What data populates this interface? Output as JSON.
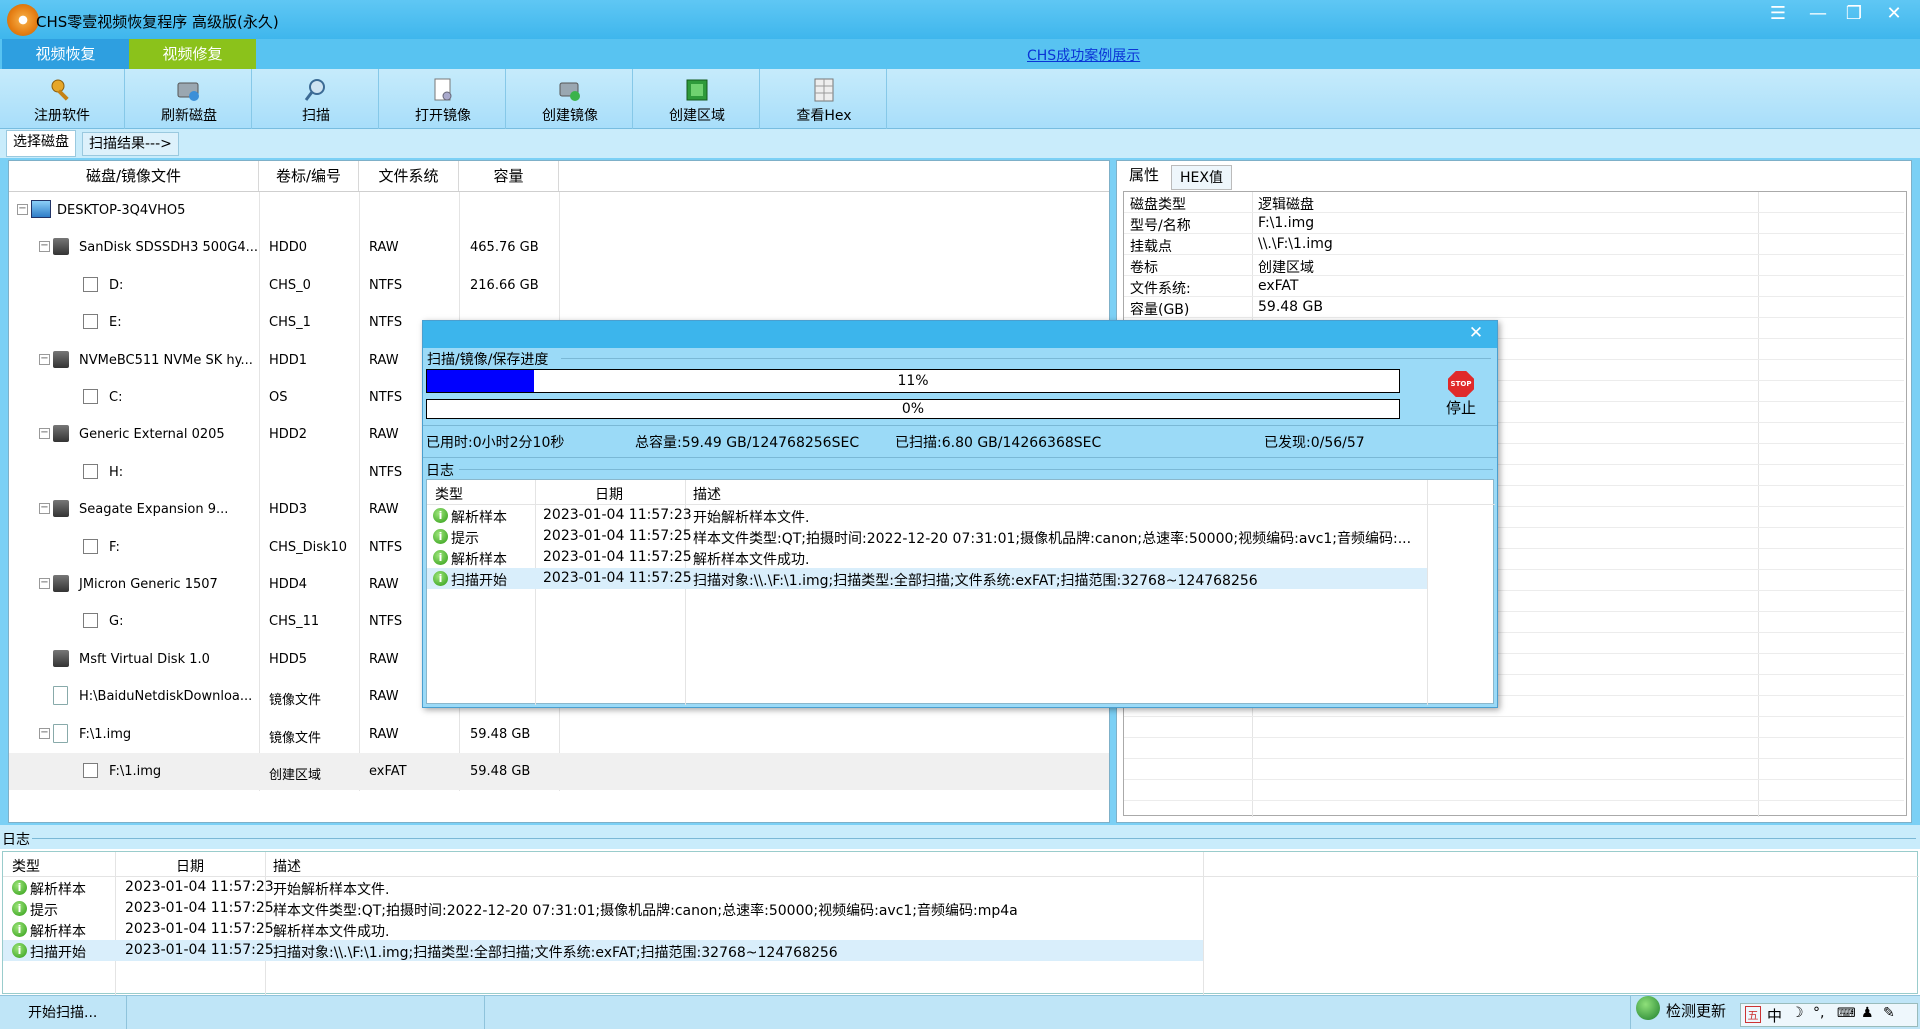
{
  "app": {
    "title": "CHS零壹视频恢复程序 高级版(永久)"
  },
  "window_buttons": [
    "☰",
    "—",
    "❐",
    "✕"
  ],
  "main_tabs": [
    "视频恢复",
    "视频修复"
  ],
  "showcase_link": "CHS成功案例展示",
  "toolbar": [
    "注册软件",
    "刷新磁盘",
    "扫描",
    "打开镜像",
    "创建镜像",
    "创建区域",
    "查看Hex"
  ],
  "sub_tabs": [
    "选择磁盘",
    "扫描结果--->"
  ],
  "disk_table": {
    "headers": [
      "磁盘/镜像文件",
      "卷标/编号",
      "文件系统",
      "容量"
    ],
    "rows": [
      {
        "name": "DESKTOP-3Q4VHO5",
        "label": "",
        "fs": "",
        "size": ""
      },
      {
        "name": "SanDisk SDSSDH3 500G4...",
        "label": "HDD0",
        "fs": "RAW",
        "size": "465.76 GB"
      },
      {
        "name": "D:",
        "label": "CHS_0",
        "fs": "NTFS",
        "size": "216.66 GB"
      },
      {
        "name": "E:",
        "label": "CHS_1",
        "fs": "NTFS",
        "size": ""
      },
      {
        "name": "NVMeBC511 NVMe SK hy...",
        "label": "HDD1",
        "fs": "RAW",
        "size": ""
      },
      {
        "name": "C:",
        "label": "OS",
        "fs": "NTFS",
        "size": ""
      },
      {
        "name": "Generic External      0205",
        "label": "HDD2",
        "fs": "RAW",
        "size": ""
      },
      {
        "name": "H:",
        "label": "",
        "fs": "NTFS",
        "size": ""
      },
      {
        "name": "Seagate Expansion      9...",
        "label": "HDD3",
        "fs": "RAW",
        "size": ""
      },
      {
        "name": "F:",
        "label": "CHS_Disk10",
        "fs": "NTFS",
        "size": ""
      },
      {
        "name": "JMicron Generic       1507",
        "label": "HDD4",
        "fs": "RAW",
        "size": ""
      },
      {
        "name": "G:",
        "label": "CHS_11",
        "fs": "NTFS",
        "size": ""
      },
      {
        "name": "Msft    Virtual Disk    1.0",
        "label": "HDD5",
        "fs": "RAW",
        "size": ""
      },
      {
        "name": "H:\\BaiduNetdiskDownloa...",
        "label": "镜像文件",
        "fs": "RAW",
        "size": ""
      },
      {
        "name": "F:\\1.img",
        "label": "镜像文件",
        "fs": "RAW",
        "size": "59.48 GB"
      },
      {
        "name": "F:\\1.img",
        "label": "创建区域",
        "fs": "exFAT",
        "size": "59.48 GB"
      }
    ]
  },
  "props": {
    "tabs": [
      "属性",
      "HEX值"
    ],
    "rows": [
      {
        "k": "磁盘类型",
        "v": "逻辑磁盘"
      },
      {
        "k": "型号/名称",
        "v": "F:\\1.img"
      },
      {
        "k": "挂载点",
        "v": "\\\\.\\F:\\1.img"
      },
      {
        "k": "卷标",
        "v": "创建区域"
      },
      {
        "k": "文件系统:",
        "v": "exFAT"
      },
      {
        "k": "容量(GB)",
        "v": "59.48 GB"
      }
    ]
  },
  "dialog": {
    "close": "✕",
    "section": "扫描/镜像/保存进度",
    "progress1": {
      "text": "11%",
      "value": 0.11
    },
    "progress2": {
      "text": "0%",
      "value": 0
    },
    "stop_icon": "STOP",
    "stop_label": "停止",
    "stats": {
      "elapsed": "已用时:0小时2分10秒",
      "total": "总容量:59.49 GB/124768256SEC",
      "scanned": "已扫描:6.80 GB/14266368SEC",
      "found": "已发现:0/56/57"
    },
    "log_title": "日志",
    "log_headers": [
      "类型",
      "日期",
      "描述"
    ],
    "log_rows": [
      {
        "type": "解析样本",
        "date": "2023-01-04 11:57:23",
        "desc": "开始解析样本文件."
      },
      {
        "type": "提示",
        "date": "2023-01-04 11:57:25",
        "desc": "样本文件类型:QT;拍摄时间:2022-12-20 07:31:01;摄像机品牌:canon;总速率:50000;视频编码:avc1;音频编码:..."
      },
      {
        "type": "解析样本",
        "date": "2023-01-04 11:57:25",
        "desc": "解析样本文件成功."
      },
      {
        "type": "扫描开始",
        "date": "2023-01-04 11:57:25",
        "desc": "扫描对象:\\\\.\\F:\\1.img;扫描类型:全部扫描;文件系统:exFAT;扫描范围:32768~124768256"
      }
    ]
  },
  "bottom_log": {
    "title": "日志",
    "headers": [
      "类型",
      "日期",
      "描述"
    ],
    "rows": [
      {
        "type": "解析样本",
        "date": "2023-01-04 11:57:23",
        "desc": "开始解析样本文件."
      },
      {
        "type": "提示",
        "date": "2023-01-04 11:57:25",
        "desc": "样本文件类型:QT;拍摄时间:2022-12-20 07:31:01;摄像机品牌:canon;总速率:50000;视频编码:avc1;音频编码:mp4a"
      },
      {
        "type": "解析样本",
        "date": "2023-01-04 11:57:25",
        "desc": "解析样本文件成功."
      },
      {
        "type": "扫描开始",
        "date": "2023-01-04 11:57:25",
        "desc": "扫描对象:\\\\.\\F:\\1.img;扫描类型:全部扫描;文件系统:exFAT;扫描范围:32768~124768256"
      }
    ]
  },
  "status": {
    "text": "开始扫描...",
    "update": "检测更新",
    "ime": "中"
  },
  "colors": {
    "accent": "#3cb5ec",
    "progress": "#0000ff",
    "selected_row": "#d9eefb",
    "tab_green": "#8bc21b"
  }
}
